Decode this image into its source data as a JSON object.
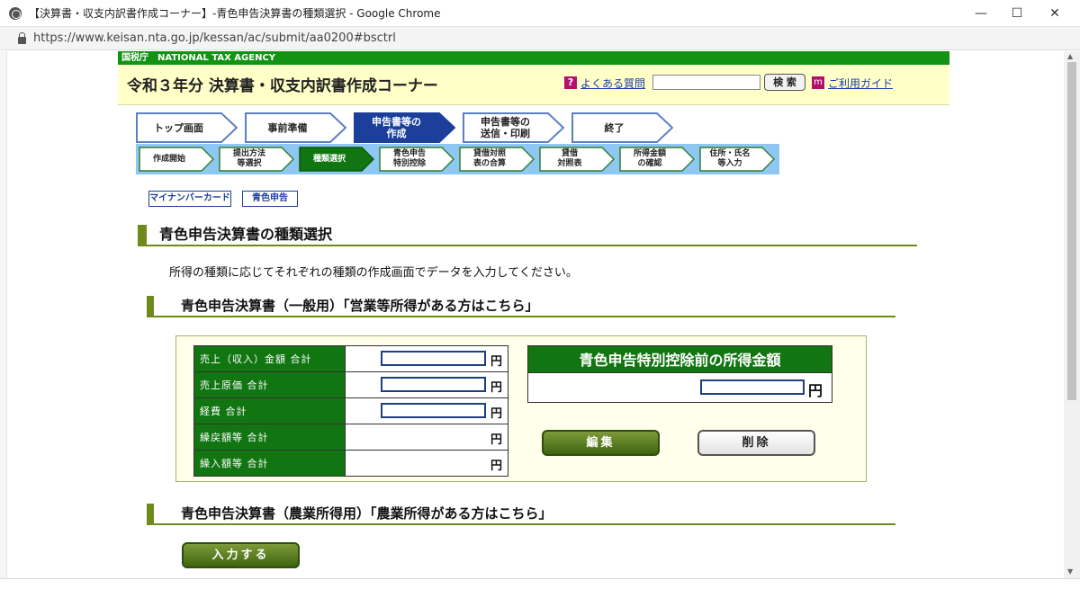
{
  "window": {
    "title": "【決算書・収支内訳書作成コーナー】-青色申告決算書の種類選択 - Google Chrome",
    "minimize": "—",
    "maximize": "☐",
    "close": "✕"
  },
  "address_bar": {
    "url": "https://www.keisan.nta.go.jp/kessan/ac/submit/aa0200#bsctrl"
  },
  "nta": {
    "agency": "国税庁　NATIONAL TAX AGENCY",
    "corner_title": "令和３年分 決算書・収支内訳書作成コーナー",
    "faq_icon": "?",
    "faq_link": "よくある質問",
    "search_button": "検 索",
    "guide_icon": "m",
    "guide_link": "ご利用ガイド"
  },
  "steps": [
    {
      "label": "トップ画面",
      "active": false
    },
    {
      "label": "事前準備",
      "active": false
    },
    {
      "label": "申告書等の\n作成",
      "active": true
    },
    {
      "label": "申告書等の\n送信・印刷",
      "active": false
    },
    {
      "label": "終了",
      "active": false
    }
  ],
  "substeps": [
    {
      "label": "作成開始",
      "active": false
    },
    {
      "label": "提出方法\n等選択",
      "active": false
    },
    {
      "label": "種類選択",
      "active": true
    },
    {
      "label": "青色申告\n特別控除",
      "active": false
    },
    {
      "label": "貸借対照\n表の合算",
      "active": false
    },
    {
      "label": "貸借\n対照表",
      "active": false
    },
    {
      "label": "所得金額\nの確認",
      "active": false
    },
    {
      "label": "住所・氏名\n等入力",
      "active": false
    }
  ],
  "tags": {
    "mynumber": "マイナンバーカード",
    "blue": "青色申告"
  },
  "page": {
    "heading": "青色申告決算書の種類選択",
    "intro": "所得の種類に応じてそれぞれの種類の作成画面でデータを入力してください。",
    "section_general": "青色申告決算書（一般用）「営業等所得がある方はこちら」",
    "section_agri": "青色申告決算書（農業所得用）「農業所得がある方はこちら」"
  },
  "general_form": {
    "rows": [
      {
        "label": "売上（収入）金額 合計",
        "value": "",
        "has_input": true
      },
      {
        "label": "売上原価 合計",
        "value": "",
        "has_input": true
      },
      {
        "label": "経費 合計",
        "value": "",
        "has_input": true
      },
      {
        "label": "繰戻額等 合計",
        "value": "",
        "has_input": false
      },
      {
        "label": "繰入額等 合計",
        "value": "",
        "has_input": false
      }
    ],
    "yen": "円",
    "result_title": "青色申告特別控除前の所得金額",
    "result_value": "",
    "edit_button": "編集",
    "delete_button": "削除"
  },
  "agri_form": {
    "input_button": "入力する"
  },
  "colors": {
    "nta_green": "#119314",
    "header_yellow": "#ffffc7",
    "active_step": "#1b3f9b",
    "active_substep": "#117611",
    "link_blue": "#1a3bb0"
  }
}
